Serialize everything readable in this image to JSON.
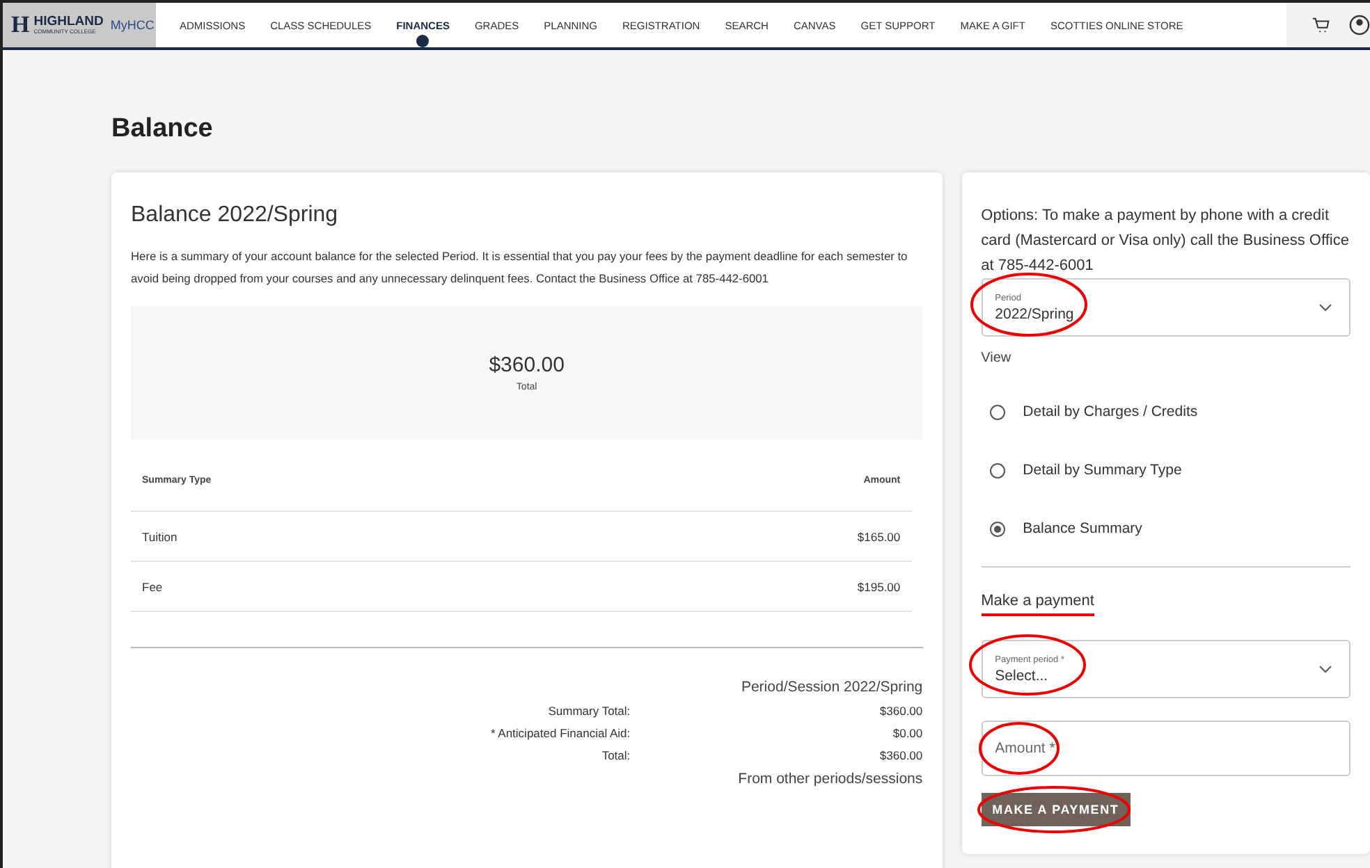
{
  "nav": {
    "logo": {
      "letter": "H",
      "title": "HIGHLAND",
      "subtitle": "COMMUNITY COLLEGE",
      "app": "MyHCC"
    },
    "items": [
      {
        "label": "ADMISSIONS",
        "selected": false
      },
      {
        "label": "CLASS SCHEDULES",
        "selected": false
      },
      {
        "label": "FINANCES",
        "selected": true
      },
      {
        "label": "GRADES",
        "selected": false
      },
      {
        "label": "PLANNING",
        "selected": false
      },
      {
        "label": "REGISTRATION",
        "selected": false
      },
      {
        "label": "SEARCH",
        "selected": false
      },
      {
        "label": "CANVAS",
        "selected": false
      },
      {
        "label": "GET SUPPORT",
        "selected": false
      },
      {
        "label": "MAKE A GIFT",
        "selected": false
      },
      {
        "label": "SCOTTIES ONLINE STORE",
        "selected": false
      }
    ]
  },
  "page_title": "Balance",
  "balance": {
    "title": "Balance 2022/Spring",
    "description": "Here is a summary of your account balance for the selected Period. It is essential that you pay your fees by the payment deadline for each semester to avoid being dropped from your courses and any unnecessary delinquent fees. Contact the Business Office at 785-442-6001",
    "total": {
      "amount": "$360.00",
      "label": "Total"
    },
    "table": {
      "columns": [
        "Summary Type",
        "Amount"
      ],
      "rows": [
        {
          "type": "Tuition",
          "amount": "$165.00"
        },
        {
          "type": "Fee",
          "amount": "$195.00"
        }
      ]
    },
    "session": {
      "heading": "Period/Session 2022/Spring",
      "lines": [
        {
          "label": "Summary Total:",
          "value": "$360.00"
        },
        {
          "label": "* Anticipated Financial Aid:",
          "value": "$0.00"
        },
        {
          "label": "Total:",
          "value": "$360.00"
        }
      ],
      "other_heading": "From other periods/sessions"
    }
  },
  "options": {
    "note": "Options: To make a payment by phone with a credit card (Mastercard or Visa only) call the Business Office at 785-442-6001",
    "period": {
      "label": "Period",
      "value": "2022/Spring",
      "circled": true
    },
    "view": {
      "label": "View",
      "choices": [
        {
          "label": "Detail by Charges / Credits",
          "selected": false
        },
        {
          "label": "Detail by Summary Type",
          "selected": false
        },
        {
          "label": "Balance Summary",
          "selected": true
        }
      ]
    },
    "payment": {
      "heading": "Make a payment",
      "underlined": true,
      "period": {
        "label": "Payment period *",
        "value": "Select...",
        "circled": true
      },
      "amount": {
        "placeholder": "Amount *",
        "circled": true
      },
      "button": {
        "label": "MAKE A PAYMENT",
        "circled": true
      }
    }
  }
}
